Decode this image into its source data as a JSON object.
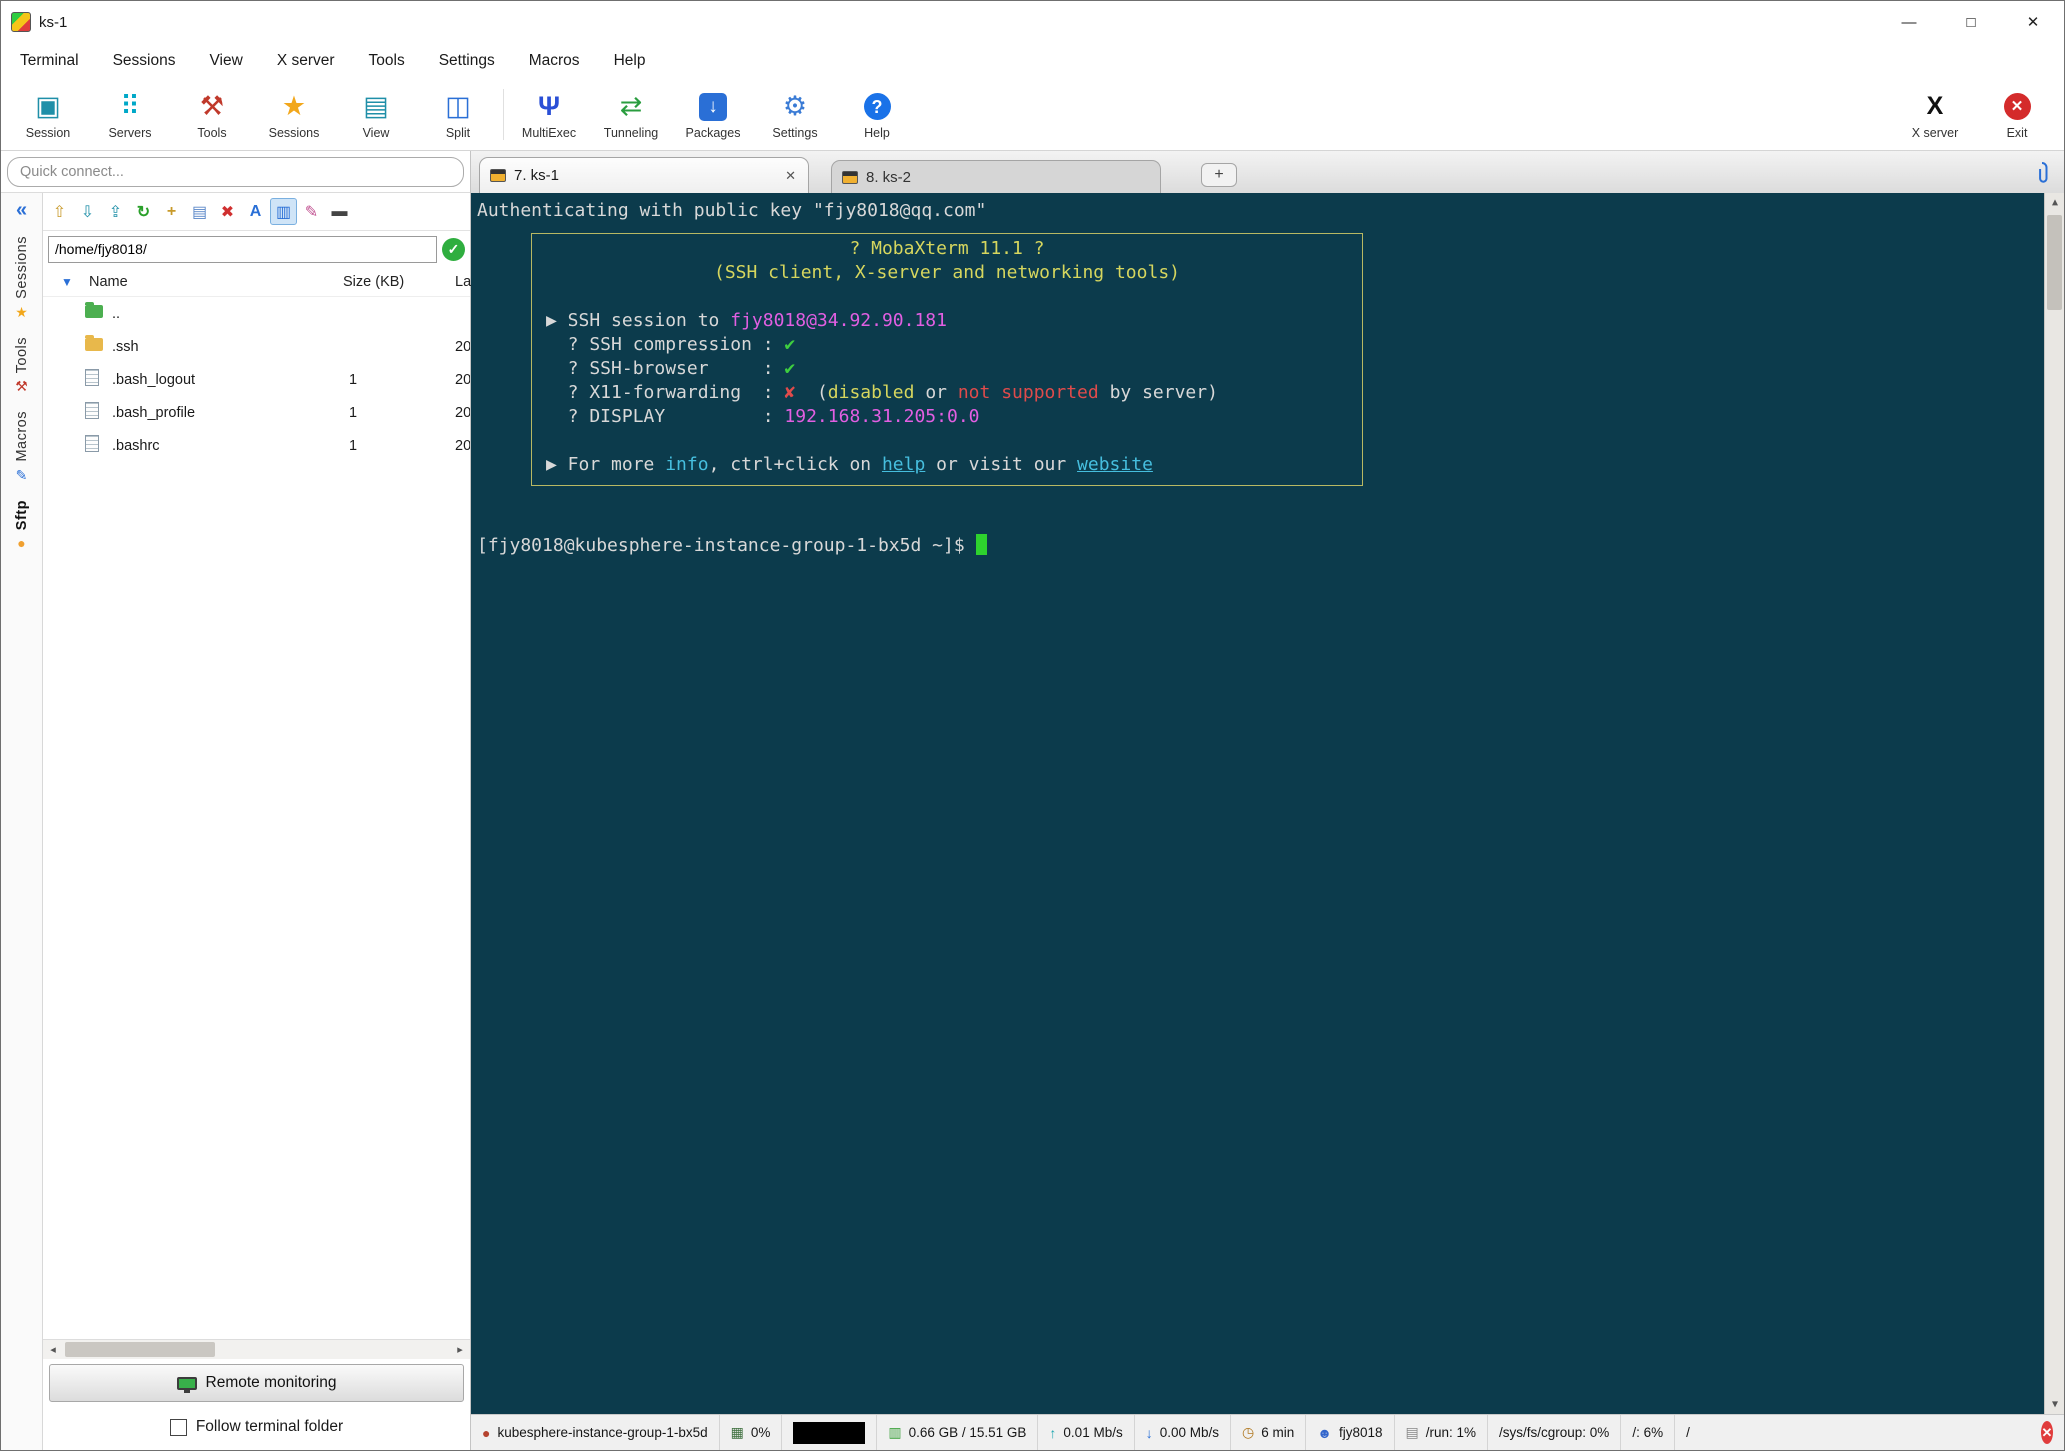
{
  "theme": {
    "terminal_bg": "#0c3b4c",
    "terminal_fg": "#d8d8d8",
    "yellow": "#d6d65e",
    "magenta": "#e25fe2",
    "green": "#3fcf3f",
    "red": "#e04b4b",
    "cyan": "#46bede",
    "cursor_green": "#2ed22e",
    "accent_blue": "#2a6fd6"
  },
  "glyphs": {
    "minimize": "—",
    "maximize": "□",
    "close": "✕",
    "collapse": "«",
    "expander": "▼",
    "tab_close": "✕",
    "tab_new": "+",
    "path_ok": "✓",
    "scroll_left": "◂",
    "scroll_right": "▸",
    "scroll_up": "▲",
    "scroll_down": "▼"
  },
  "titlebar": {
    "title": "ks-1"
  },
  "menu": {
    "items": [
      "Terminal",
      "Sessions",
      "View",
      "X server",
      "Tools",
      "Settings",
      "Macros",
      "Help"
    ]
  },
  "toolbar": {
    "items": [
      {
        "label": "Session",
        "glyph": "▣"
      },
      {
        "label": "Servers",
        "glyph": "⠿"
      },
      {
        "label": "Tools",
        "glyph": "⚒"
      },
      {
        "label": "Sessions",
        "glyph": "★"
      },
      {
        "label": "View",
        "glyph": "▤"
      },
      {
        "label": "Split",
        "glyph": "◫"
      },
      {
        "label": "MultiExec",
        "glyph": "Ψ"
      },
      {
        "label": "Tunneling",
        "glyph": "⇄"
      },
      {
        "label": "Packages",
        "glyph": "↓"
      },
      {
        "label": "Settings",
        "glyph": "⚙"
      },
      {
        "label": "Help",
        "glyph": "?"
      }
    ],
    "right": [
      {
        "label": "X server",
        "glyph": "X"
      },
      {
        "label": "Exit",
        "glyph": "✕"
      }
    ]
  },
  "quick_connect": {
    "placeholder": "Quick connect..."
  },
  "sidebar": {
    "items": [
      {
        "label": "Sessions",
        "glyph": "★",
        "color": "#f2a71b"
      },
      {
        "label": "Tools",
        "glyph": "⚒",
        "color": "#c0392b"
      },
      {
        "label": "Macros",
        "glyph": "✎",
        "color": "#2a6fd6"
      },
      {
        "label": "Sftp",
        "glyph": "●",
        "color": "#f0a030"
      }
    ]
  },
  "sftp": {
    "tools": [
      {
        "name": "parent-folder",
        "glyph": "⇧"
      },
      {
        "name": "download",
        "glyph": "⇩"
      },
      {
        "name": "upload",
        "glyph": "⇪"
      },
      {
        "name": "refresh",
        "glyph": "↻"
      },
      {
        "name": "new-folder",
        "glyph": "+"
      },
      {
        "name": "new-file",
        "glyph": "▤"
      },
      {
        "name": "delete",
        "glyph": "✖"
      },
      {
        "name": "encoding",
        "glyph": "A"
      },
      {
        "name": "columns",
        "glyph": "▥"
      },
      {
        "name": "edit",
        "glyph": "✎"
      },
      {
        "name": "terminal-folder",
        "glyph": "▬"
      }
    ],
    "path": "/home/fjy8018/",
    "columns": [
      "Name",
      "Size (KB)",
      "La"
    ],
    "rows": [
      {
        "name": "..",
        "size": "",
        "modified": ""
      },
      {
        "name": ".ssh",
        "size": "",
        "modified": "20"
      },
      {
        "name": ".bash_logout",
        "size": "1",
        "modified": "20"
      },
      {
        "name": ".bash_profile",
        "size": "1",
        "modified": "20"
      },
      {
        "name": ".bashrc",
        "size": "1",
        "modified": "20"
      }
    ],
    "remote_monitoring": "Remote monitoring",
    "follow_label": "Follow terminal folder"
  },
  "tabs": {
    "items": [
      {
        "label": "7. ks-1"
      },
      {
        "label": "8. ks-2"
      }
    ]
  },
  "terminal": {
    "auth_line": "Authenticating with public key \"fjy8018@qq.com\"",
    "banner": {
      "title1": "? MobaXterm 11.1 ?",
      "title2": "(SSH client, X-server and networking tools)",
      "ssh_prefix": "▶ SSH session to ",
      "ssh_target": "fjy8018@34.92.90.181",
      "compression_label": "  ? SSH compression : ",
      "browser_label": "  ? SSH-browser     : ",
      "check_mark": "✔",
      "x11_label": "  ? X11-forwarding  : ",
      "x11_mark": "✘",
      "x11_open": "  (",
      "x11_disabled": "disabled",
      "x11_or": " or ",
      "x11_not_supported": "not supported",
      "x11_close": " by server)",
      "display_label": "  ? DISPLAY         : ",
      "display_value": "192.168.31.205:0.0",
      "info_prefix": "▶ For more ",
      "info_link": "info",
      "info_mid": ", ctrl+click on ",
      "help_link": "help",
      "info_mid2": " or visit our ",
      "website_link": "website"
    },
    "prompt": "[fjy8018@kubesphere-instance-group-1-bx5d ~]$ "
  },
  "statusbar": {
    "host": "kubesphere-instance-group-1-bx5d",
    "cpu": "0%",
    "memory": "0.66 GB / 15.51 GB",
    "upload": "0.01 Mb/s",
    "download": "0.00 Mb/s",
    "uptime": "6 min",
    "user": "fjy8018",
    "disk_run": "/run: 1%",
    "disk_cgroup": "/sys/fs/cgroup: 0%",
    "disk_root": "/: 6%",
    "disk_trunc": "/"
  }
}
